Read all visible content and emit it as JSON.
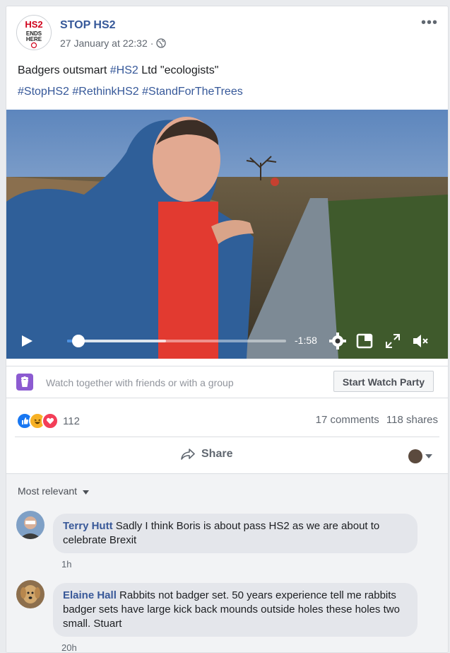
{
  "post": {
    "page_name": "STOP HS2",
    "timestamp": "27 January at 22:32",
    "separator": "·",
    "text_prefix": "Badgers outsmart ",
    "text_link": "#HS2",
    "text_suffix": " Ltd \"ecologists\"",
    "hashtags": [
      "#StopHS2",
      "#RethinkHS2",
      "#StandForTheTrees"
    ],
    "logo_text": {
      "line1": "HS2",
      "line2": "ENDS",
      "line3": "HERE"
    }
  },
  "video": {
    "time_remaining": "-1:58",
    "progress_fraction": 0.05,
    "buffered_fraction": 0.45
  },
  "watch_party": {
    "text": "Watch together with friends or with a group",
    "button_label": "Start Watch Party"
  },
  "engagement": {
    "reaction_count": "112",
    "comments": "17 comments",
    "shares": "118 shares"
  },
  "actions": {
    "share_label": "Share"
  },
  "comments_section": {
    "sort_label": "Most relevant",
    "items": [
      {
        "author": "Terry Hutt",
        "text": "Sadly I think Boris is about pass HS2 as we are about to celebrate Brexit",
        "time": "1h"
      },
      {
        "author": "Elaine Hall",
        "text": "Rabbits not badger set. 50 years experience tell me rabbits badger sets have large kick back mounds outside holes these holes two small. Stuart",
        "time": "20h"
      }
    ]
  },
  "colors": {
    "link": "#365899",
    "progress": "#4a90e2",
    "watch_icon": "#8c5bd1"
  }
}
